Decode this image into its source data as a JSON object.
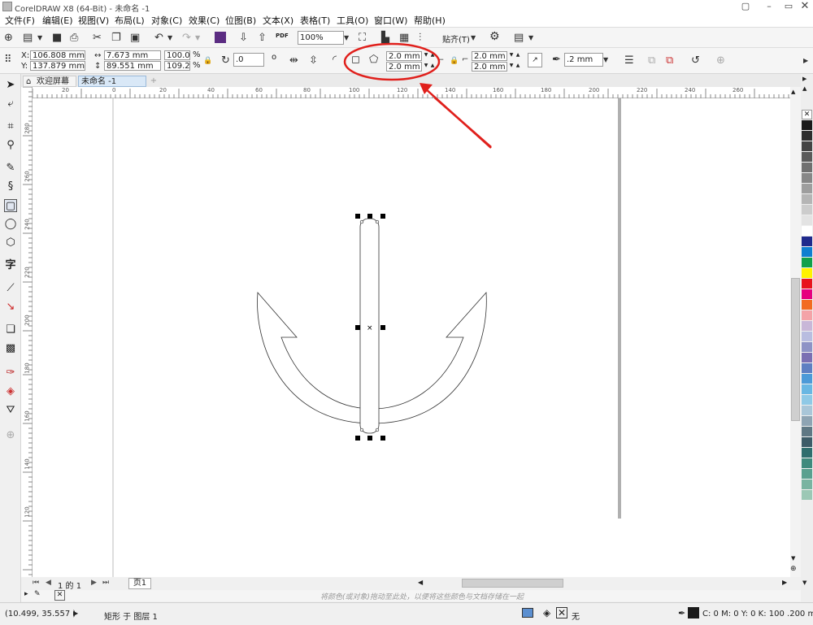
{
  "window": {
    "title": "CorelDRAW X8 (64-Bit) - 未命名 -1",
    "controls": {
      "restore": "▢",
      "minimize": "–",
      "maximize": "▭"
    }
  },
  "menu": [
    "文件(F)",
    "编辑(E)",
    "视图(V)",
    "布局(L)",
    "对象(C)",
    "效果(C)",
    "位图(B)",
    "文本(X)",
    "表格(T)",
    "工具(O)",
    "窗口(W)",
    "帮助(H)"
  ],
  "standard_toolbar": {
    "zoom_value": "100%",
    "pdf_label": "PDF",
    "snap_label": "贴齐(T)"
  },
  "property_bar": {
    "x_label": "X:",
    "x_value": "106.808 mm",
    "y_label": "Y:",
    "y_value": "137.879 mm",
    "width_value": "7.673 mm",
    "height_value": "89.551 mm",
    "scale_w": "100.0",
    "scale_h": "109.2",
    "percent": "%",
    "rotation_value": ".0",
    "degree": "o",
    "corner_top_left": "2.0 mm",
    "corner_bottom_left": "2.0 mm",
    "corner_top_right": "2.0 mm",
    "corner_bottom_right": "2.0 mm",
    "outline_width": ".2 mm"
  },
  "tabs": {
    "welcome": "欢迎屏幕",
    "document": "未命名 -1"
  },
  "rulers": {
    "h_ticks": [
      "20",
      "0",
      "20",
      "40",
      "60",
      "80",
      "100",
      "120",
      "140",
      "160",
      "180",
      "200",
      "220",
      "240",
      "260"
    ],
    "v_ticks": [
      "280",
      "260",
      "240",
      "220",
      "200",
      "180",
      "160",
      "140",
      "120",
      "100",
      "80",
      "60",
      "40",
      "20"
    ]
  },
  "page_nav": {
    "counter": "1 的 1",
    "page_tab": "页1"
  },
  "colorbar_hint": "将颜色(或对象)拖动至此处，以便将这些颜色与文档存储在一起",
  "status": {
    "coords": "(10.499, 35.557 )",
    "object_info": "矩形 于 图层 1",
    "fill_none": "无",
    "outline_info": "C: 0 M: 0 Y: 0 K: 100  .200 mm"
  },
  "colors": {
    "annotation_red": "#e0201c",
    "palette": [
      "#1a1a1a",
      "#2e2e2e",
      "#444444",
      "#5a5a5a",
      "#707070",
      "#878787",
      "#9e9e9e",
      "#b5b5b5",
      "#cccccc",
      "#e3e3e3",
      "#ffffff",
      "#1f2a8c",
      "#0f7fd0",
      "#11a04a",
      "#fff200",
      "#e8141c",
      "#e6007e",
      "#f26b21",
      "#f4a3a8",
      "#c8b7d8",
      "#b9bde0",
      "#8e93c6",
      "#7a6fb3",
      "#5e7fc2",
      "#4c9ad8",
      "#69b7e3",
      "#8fc9e6",
      "#a9c6d8",
      "#8ea4b3",
      "#5f7884",
      "#3d5c68",
      "#2f6e6e",
      "#3f8a7d",
      "#5aa08f",
      "#79b4a1",
      "#9cc8b5"
    ]
  },
  "icons": [
    "pick-tool-icon",
    "shape-tool-icon",
    "crop-tool-icon",
    "zoom-tool-icon",
    "freehand-tool-icon",
    "artistic-media-icon",
    "rectangle-tool-icon",
    "ellipse-tool-icon",
    "polygon-tool-icon",
    "text-tool-icon",
    "parallel-dimension-icon",
    "connector-tool-icon",
    "drop-shadow-icon",
    "transparency-icon",
    "eyedropper-icon",
    "interactive-fill-icon",
    "smart-fill-icon",
    "add-tool-icon"
  ]
}
